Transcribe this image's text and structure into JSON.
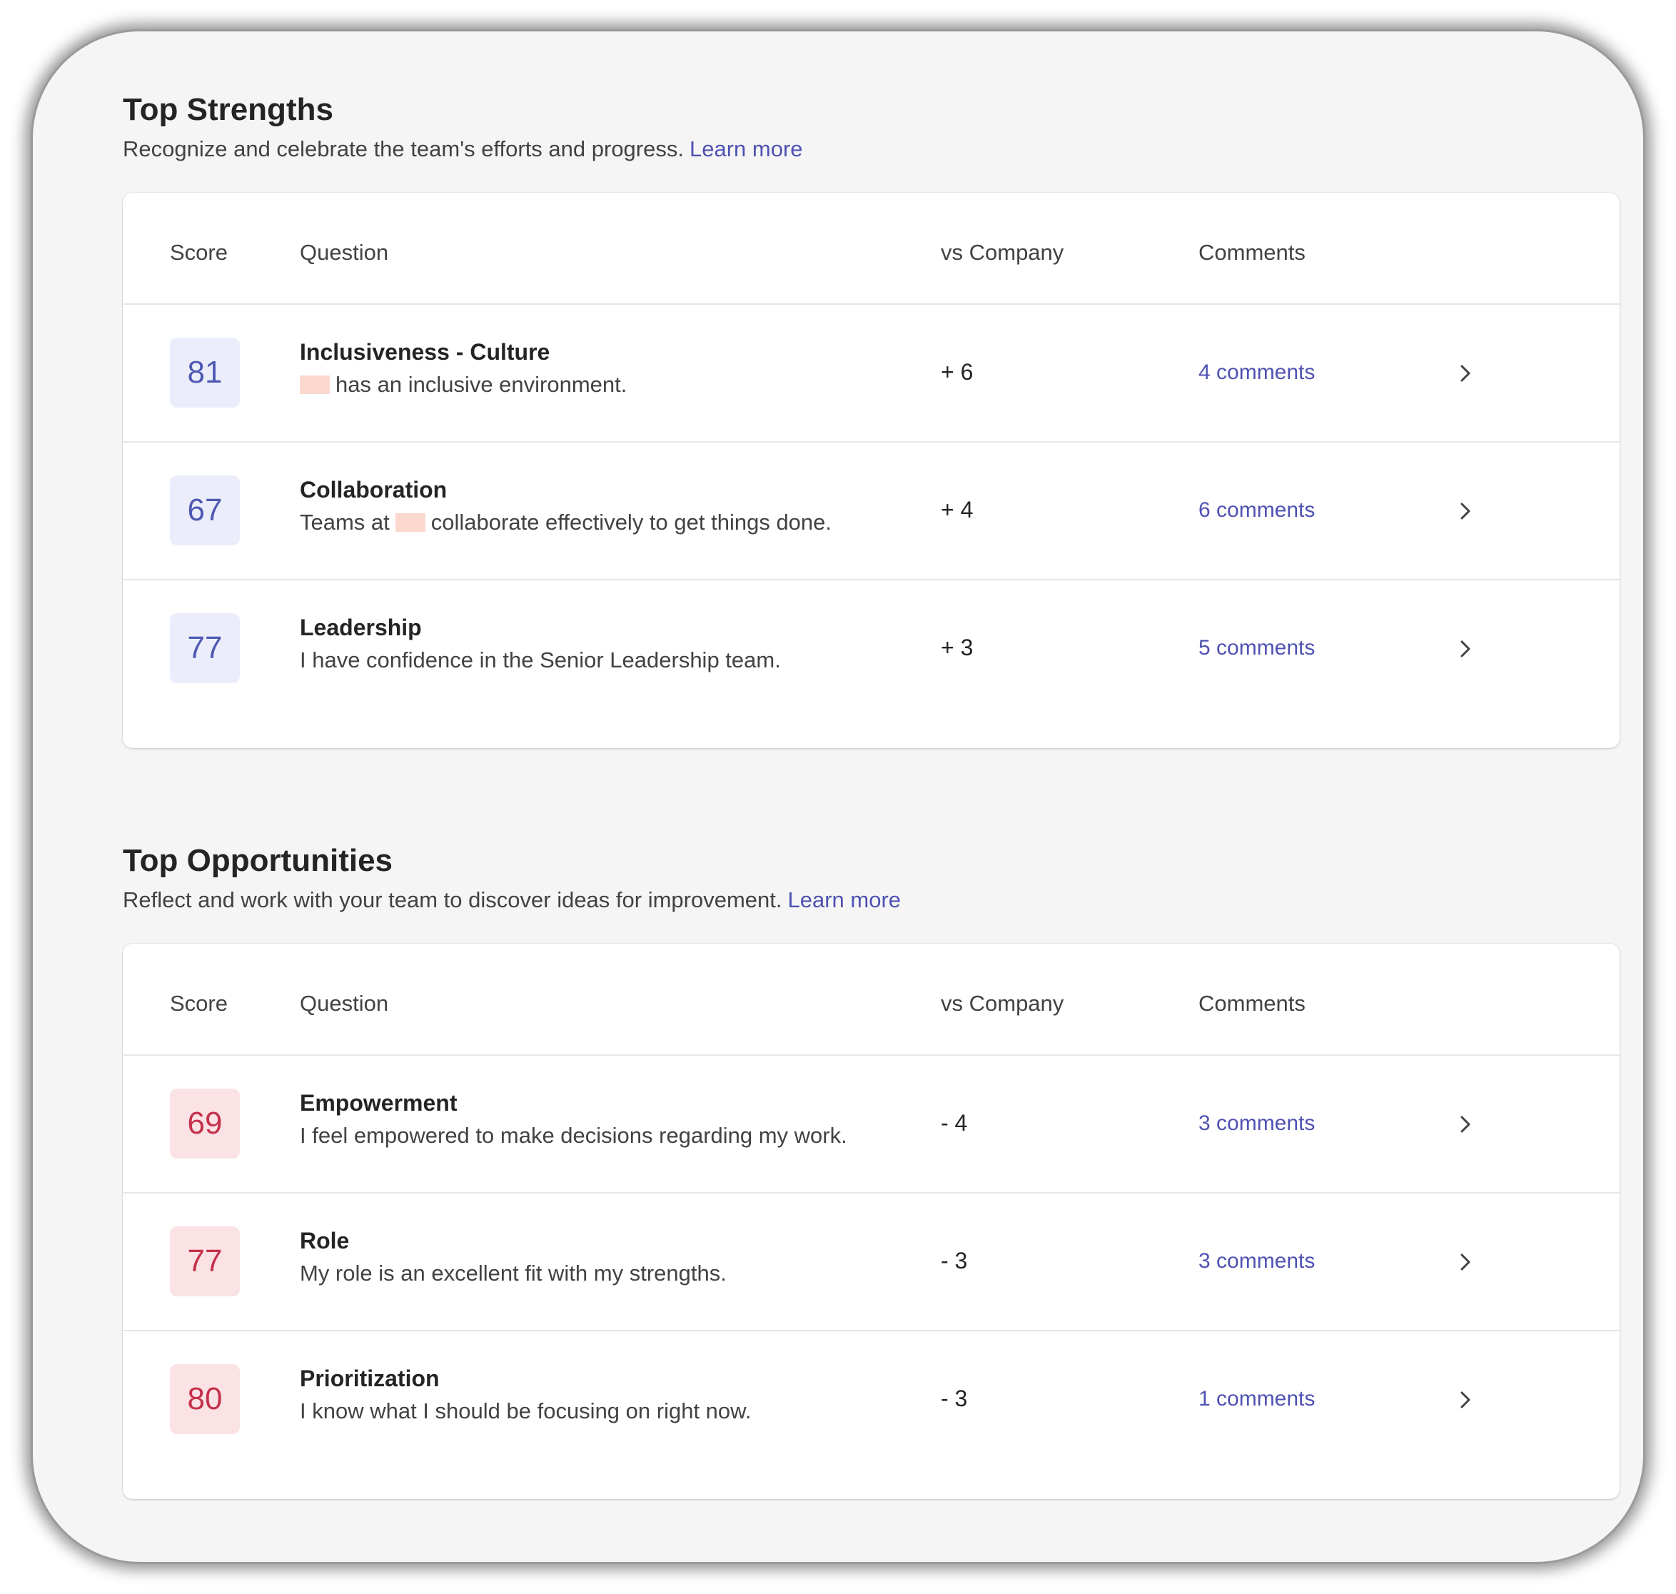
{
  "strengths": {
    "title": "Top Strengths",
    "subtitle": "Recognize and celebrate the team's efforts and progress.",
    "learn_more": "Learn more",
    "headers": {
      "score": "Score",
      "question": "Question",
      "vs": "vs Company",
      "comments": "Comments"
    },
    "rows": [
      {
        "score": "81",
        "title": "Inclusiveness - Culture",
        "text_before": "",
        "text_after": "has an inclusive environment.",
        "delta": "+ 6",
        "comments": "4 comments"
      },
      {
        "score": "67",
        "title": "Collaboration",
        "text_before": "Teams at",
        "text_after": "collaborate effectively to get things done.",
        "delta": "+ 4",
        "comments": "6 comments"
      },
      {
        "score": "77",
        "title": "Leadership",
        "text": "I have confidence in the Senior Leadership team.",
        "delta": "+ 3",
        "comments": "5 comments"
      }
    ]
  },
  "opportunities": {
    "title": "Top Opportunities",
    "subtitle": "Reflect and work with your team to discover ideas for improvement.",
    "learn_more": "Learn more",
    "headers": {
      "score": "Score",
      "question": "Question",
      "vs": "vs Company",
      "comments": "Comments"
    },
    "rows": [
      {
        "score": "69",
        "title": "Empowerment",
        "text": "I feel empowered to make decisions regarding my work.",
        "delta": "- 4",
        "comments": "3 comments"
      },
      {
        "score": "77",
        "title": "Role",
        "text": "My role is an excellent fit with my strengths.",
        "delta": "- 3",
        "comments": "3 comments"
      },
      {
        "score": "80",
        "title": "Prioritization",
        "text": "I know what I should be focusing on right now.",
        "delta": "- 3",
        "comments": "1 comments"
      }
    ]
  },
  "colors": {
    "positive_badge_bg": "#ebeefa",
    "positive_badge_text": "#4f59b4",
    "negative_badge_bg": "#fbe2e5",
    "negative_badge_text": "#c4314b",
    "link": "#4f52b2",
    "redaction": "#fbd9cf"
  },
  "icons": {
    "row_action": "chevron-right-icon"
  }
}
